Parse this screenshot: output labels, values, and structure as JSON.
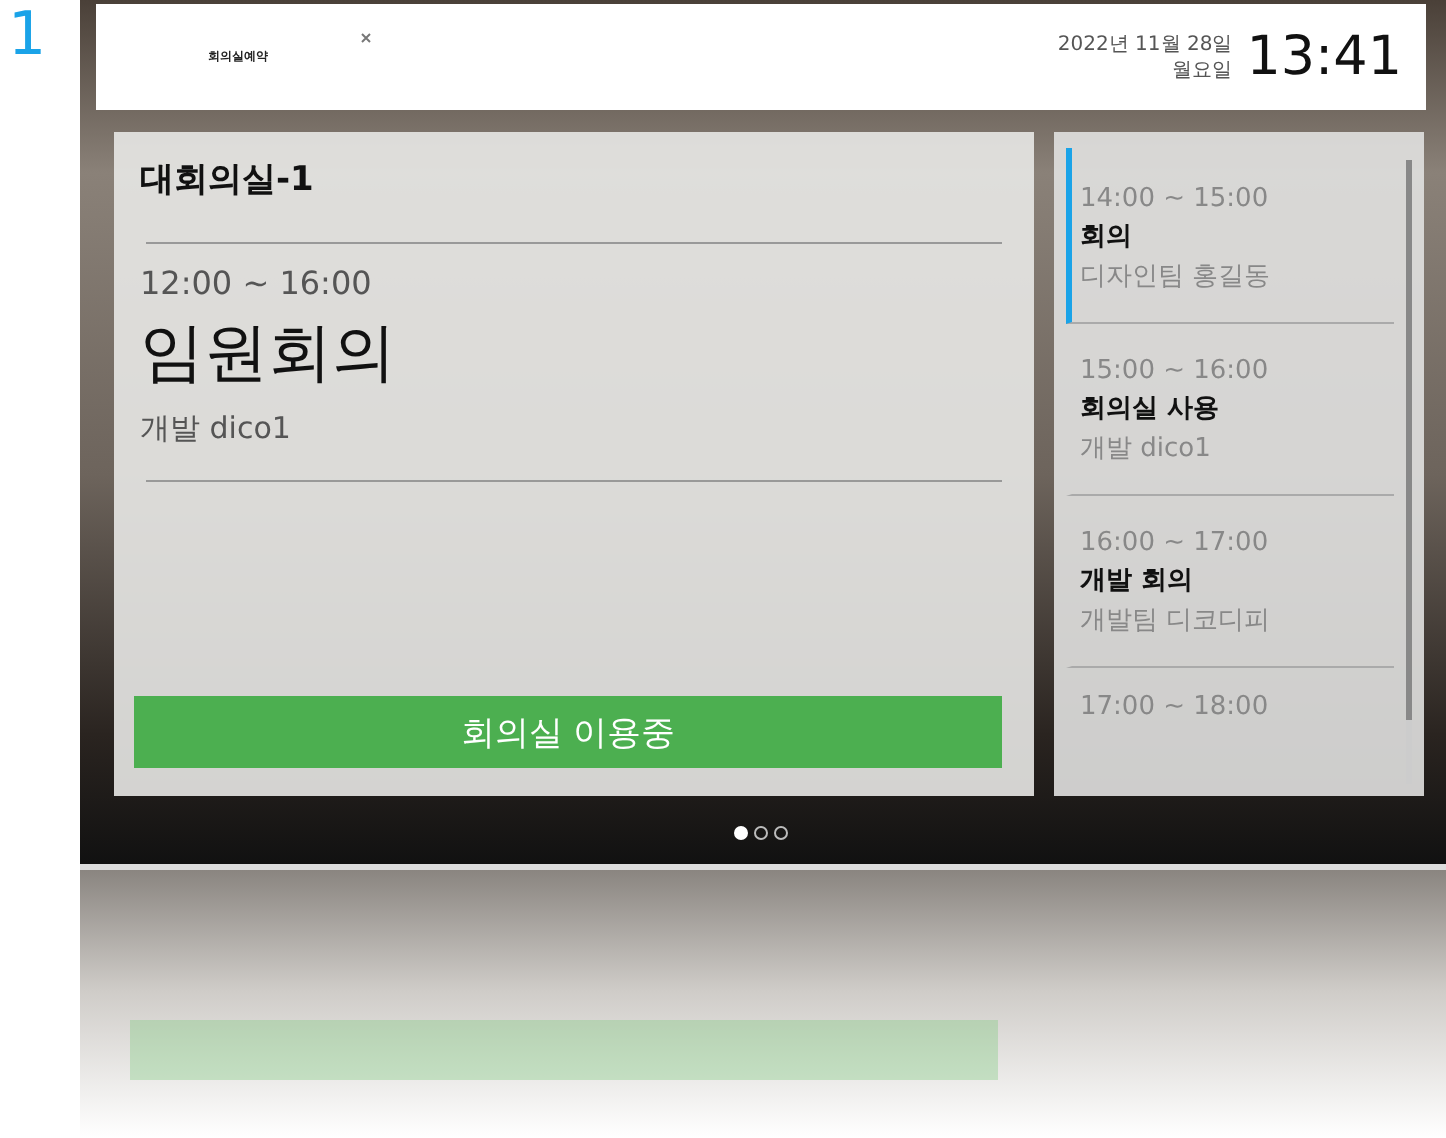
{
  "slide_number": "1",
  "header": {
    "logo": "회의실예약",
    "date": "2022년 11월 28일",
    "weekday": "월요일",
    "clock": "13:41"
  },
  "room": {
    "name": "대회의실-1",
    "time": "12:00 ~ 16:00",
    "title": "임원회의",
    "organizer": "개발 dico1",
    "status_button": "회의실 이용중"
  },
  "schedule": [
    {
      "time": "14:00 ~ 15:00",
      "title": "회의",
      "organizer": "디자인팀 홍길동",
      "selected": true
    },
    {
      "time": "15:00 ~ 16:00",
      "title": "회의실 사용",
      "organizer": "개발 dico1",
      "selected": false
    },
    {
      "time": "16:00 ~ 17:00",
      "title": "개발 회의",
      "organizer": "개발팀 디코디피",
      "selected": false
    },
    {
      "time": "17:00 ~ 18:00",
      "selected": false
    }
  ],
  "pages": [
    {
      "selected": true
    },
    {
      "selected": false
    },
    {
      "selected": false
    }
  ]
}
